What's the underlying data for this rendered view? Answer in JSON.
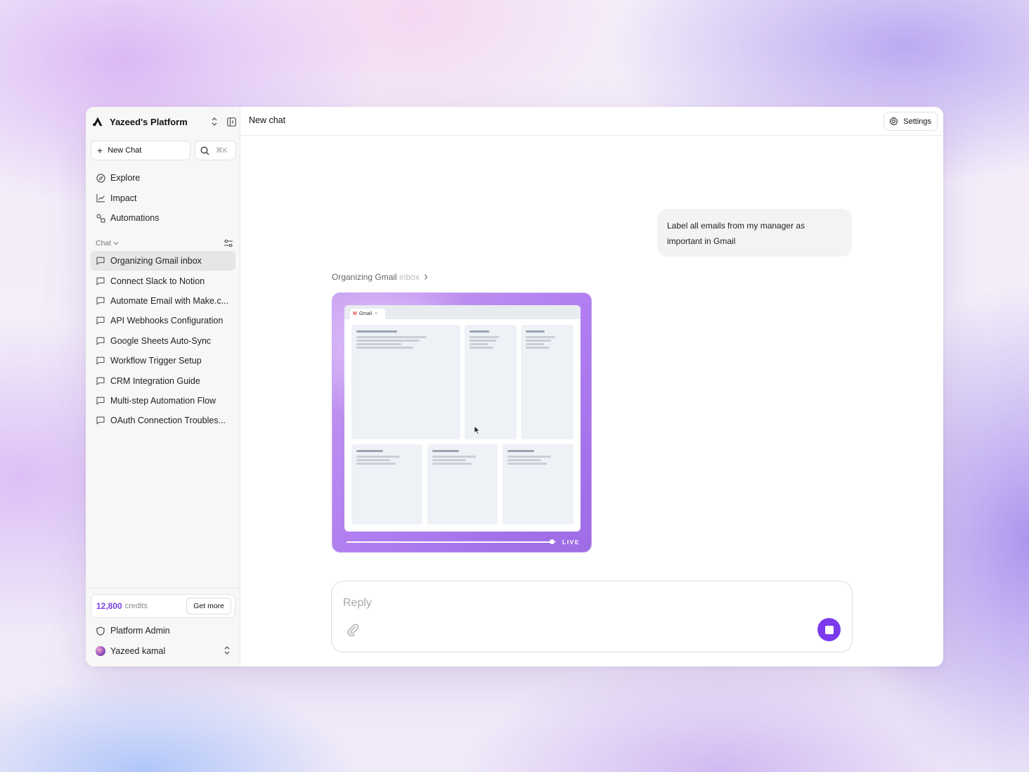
{
  "colors": {
    "accent": "#7c3aed",
    "credits_accent": "#7b3fe4",
    "preview_gradient": "#b17ff0"
  },
  "sidebar": {
    "workspace_name": "Yazeed's Platform",
    "workspace_logo_icon": "platform-logo",
    "new_chat_label": "New Chat",
    "search_shortcut": "⌘K",
    "nav": [
      {
        "label": "Explore",
        "icon": "compass-icon"
      },
      {
        "label": "Impact",
        "icon": "line-chart-icon"
      },
      {
        "label": "Automations",
        "icon": "automations-icon"
      }
    ],
    "chat_section_label": "Chat",
    "chats": [
      {
        "label": "Organizing Gmail inbox",
        "active": true
      },
      {
        "label": "Connect Slack to Notion"
      },
      {
        "label": "Automate Email with Make.c..."
      },
      {
        "label": "API Webhooks Configuration"
      },
      {
        "label": "Google Sheets Auto-Sync"
      },
      {
        "label": "Workflow Trigger Setup"
      },
      {
        "label": "CRM Integration Guide"
      },
      {
        "label": "Multi-step Automation Flow"
      },
      {
        "label": "OAuth Connection Troubles..."
      }
    ],
    "credits": {
      "amount": "12,800",
      "unit": "credits",
      "get_more_label": "Get more"
    },
    "platform_admin_label": "Platform Admin",
    "user_name": "Yazeed kamal"
  },
  "main": {
    "title": "New chat",
    "settings_label": "Settings",
    "user_message": "Label all emails from my manager as important in Gmail",
    "step_label_main": "Organizing Gmail ",
    "step_label_fade": "inbox",
    "preview": {
      "tab_label": "Gmail",
      "live_label": "LIVE",
      "progress": 0.98
    },
    "composer": {
      "placeholder": "Reply"
    }
  }
}
